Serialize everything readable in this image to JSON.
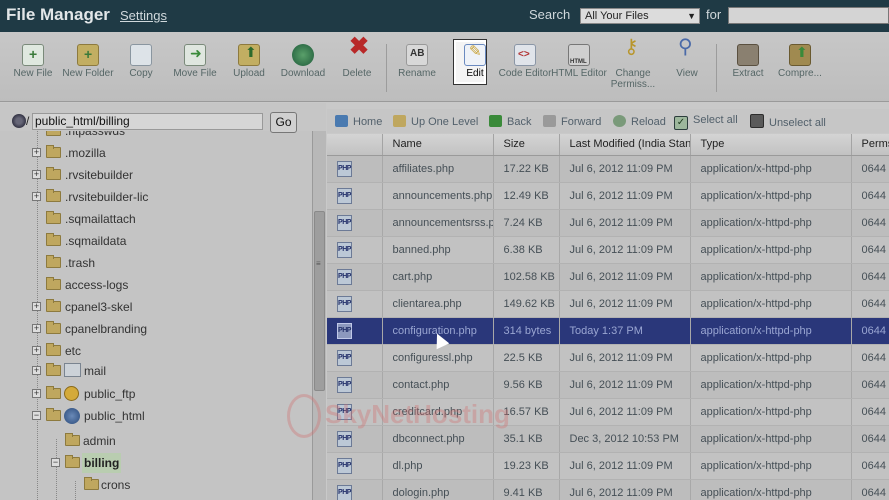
{
  "app": {
    "title": "File Manager",
    "settings_label": "Settings"
  },
  "search": {
    "label": "Search",
    "scope": "All Your Files",
    "for_label": "for",
    "query": ""
  },
  "toolbar": [
    {
      "label": "New File",
      "icon": "new-file-icon",
      "color": "#5a9a5a"
    },
    {
      "label": "New Folder",
      "icon": "new-folder-icon",
      "color": "#a89444"
    },
    {
      "label": "Copy",
      "icon": "copy-icon",
      "color": "#8fa0ac"
    },
    {
      "label": "Move File",
      "icon": "move-file-icon",
      "color": "#5c8a5c"
    },
    {
      "label": "Upload",
      "icon": "upload-icon",
      "color": "#8a9a3c"
    },
    {
      "label": "Download",
      "icon": "download-icon",
      "color": "#3c7a4a"
    },
    {
      "label": "Delete",
      "icon": "delete-icon",
      "color": "#b83030"
    },
    {
      "label": "Rename",
      "icon": "rename-icon",
      "color": "#9a9a9a"
    },
    {
      "label": "Edit",
      "icon": "edit-icon",
      "color": "#6a8ac0"
    },
    {
      "label": "Code Editor",
      "icon": "code-editor-icon",
      "color": "#8a9ab0"
    },
    {
      "label": "HTML Editor",
      "icon": "html-editor-icon",
      "color": "#8c8c8c"
    },
    {
      "label": "Change Permiss...",
      "icon": "key-icon",
      "color": "#b89a3c"
    },
    {
      "label": "View",
      "icon": "magnifier-icon",
      "color": "#5a7ab0"
    },
    {
      "label": "Extract",
      "icon": "extract-icon",
      "color": "#7a6a5a"
    },
    {
      "label": "Compre...",
      "icon": "compress-icon",
      "color": "#8a7a4a"
    }
  ],
  "path": {
    "value": "public_html/billing",
    "go_label": "Go",
    "prefix": "/"
  },
  "tree": [
    {
      "label": ".htpasswds"
    },
    {
      "label": ".mozilla"
    },
    {
      "label": ".rvsitebuilder"
    },
    {
      "label": ".rvsitebuilder-lic"
    },
    {
      "label": ".sqmailattach"
    },
    {
      "label": ".sqmaildata"
    },
    {
      "label": ".trash"
    },
    {
      "label": "access-logs"
    },
    {
      "label": "cpanel3-skel"
    },
    {
      "label": "cpanelbranding"
    },
    {
      "label": "etc"
    },
    {
      "label": "mail"
    },
    {
      "label": "public_ftp"
    },
    {
      "label": "public_html"
    },
    {
      "label": "admin"
    },
    {
      "label": "billing"
    },
    {
      "label": "crons"
    }
  ],
  "nav": {
    "home": "Home",
    "up": "Up One Level",
    "back": "Back",
    "forward": "Forward",
    "reload": "Reload",
    "select_all": "Select all",
    "unselect_all": "Unselect all"
  },
  "table": {
    "headers": [
      "",
      "Name",
      "Size",
      "Last Modified (India Standard Time)",
      "Type",
      "Perms"
    ],
    "icon_label": "PHP",
    "rows": [
      {
        "name": "affiliates.php",
        "size": "17.22 KB",
        "modified": "Jul 6, 2012 11:09 PM",
        "type": "application/x-httpd-php",
        "perms": "0644"
      },
      {
        "name": "announcements.php",
        "size": "12.49 KB",
        "modified": "Jul 6, 2012 11:09 PM",
        "type": "application/x-httpd-php",
        "perms": "0644"
      },
      {
        "name": "announcementsrss.php",
        "size": "7.24 KB",
        "modified": "Jul 6, 2012 11:09 PM",
        "type": "application/x-httpd-php",
        "perms": "0644"
      },
      {
        "name": "banned.php",
        "size": "6.38 KB",
        "modified": "Jul 6, 2012 11:09 PM",
        "type": "application/x-httpd-php",
        "perms": "0644"
      },
      {
        "name": "cart.php",
        "size": "102.58 KB",
        "modified": "Jul 6, 2012 11:09 PM",
        "type": "application/x-httpd-php",
        "perms": "0644"
      },
      {
        "name": "clientarea.php",
        "size": "149.62 KB",
        "modified": "Jul 6, 2012 11:09 PM",
        "type": "application/x-httpd-php",
        "perms": "0644"
      },
      {
        "name": "configuration.php",
        "size": "314 bytes",
        "modified": "Today 1:37 PM",
        "type": "application/x-httpd-php",
        "perms": "0644"
      },
      {
        "name": "configuressl.php",
        "size": "22.5 KB",
        "modified": "Jul 6, 2012 11:09 PM",
        "type": "application/x-httpd-php",
        "perms": "0644"
      },
      {
        "name": "contact.php",
        "size": "9.56 KB",
        "modified": "Jul 6, 2012 11:09 PM",
        "type": "application/x-httpd-php",
        "perms": "0644"
      },
      {
        "name": "creditcard.php",
        "size": "16.57 KB",
        "modified": "Jul 6, 2012 11:09 PM",
        "type": "application/x-httpd-php",
        "perms": "0644"
      },
      {
        "name": "dbconnect.php",
        "size": "35.1 KB",
        "modified": "Dec 3, 2012 10:53 PM",
        "type": "application/x-httpd-php",
        "perms": "0644"
      },
      {
        "name": "dl.php",
        "size": "19.23 KB",
        "modified": "Jul 6, 2012 11:09 PM",
        "type": "application/x-httpd-php",
        "perms": "0644"
      },
      {
        "name": "dologin.php",
        "size": "9.41 KB",
        "modified": "Jul 6, 2012 11:09 PM",
        "type": "application/x-httpd-php",
        "perms": "0644"
      }
    ]
  },
  "watermark": "SkyNetHosting"
}
